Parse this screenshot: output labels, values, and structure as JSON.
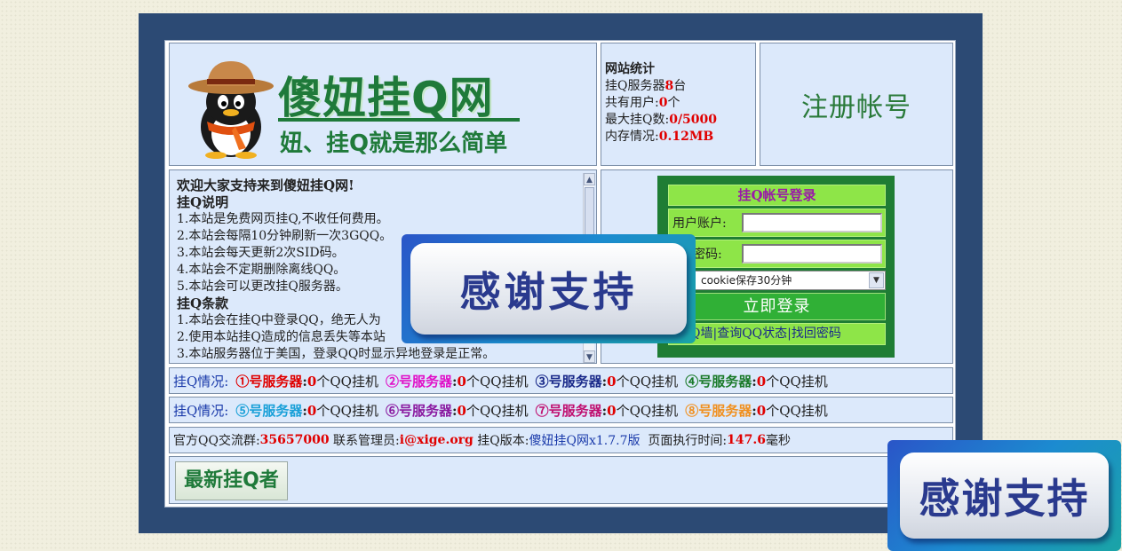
{
  "header": {
    "logo_title": "傻妞挂Q网",
    "logo_slogan": "妞、挂Q就是那么简单",
    "register_link": "注册帐号"
  },
  "stats": {
    "title": "网站统计",
    "servers_label": "挂Q服务器",
    "servers_value": "8",
    "servers_unit": "台",
    "users_label": "共有用户:",
    "users_value": "0",
    "users_unit": "个",
    "max_label": "最大挂Q数:",
    "max_value": "0/5000",
    "memory_label": "内存情况:",
    "memory_value": "0.12MB"
  },
  "info": {
    "welcome": "欢迎大家支持来到傻妞挂Q网!",
    "desc_head": "挂Q说明",
    "desc_items": [
      "1.本站是免费网页挂Q,不收任何费用。",
      "2.本站会每隔10分钟刷新一次3GQQ。",
      "3.本站会每天更新2次SID码。",
      "4.本站会不定期删除离线QQ。",
      "5.本站会可以更改挂Q服务器。"
    ],
    "terms_head": "挂Q条款",
    "terms_items": [
      "1.本站会在挂Q中登录QQ，绝无人为",
      "2.使用本站挂Q造成的信息丢失等本站",
      "3.本站服务器位于美国，登录QQ时显示异地登录是正常。"
    ]
  },
  "login": {
    "title": "挂Q帐号登录",
    "account_label": "用户账户:",
    "account_value": "",
    "password_label": "QQ密码:",
    "password_value": "",
    "cookie_select": "cookie保存30分钟",
    "submit": "立即登录",
    "links": [
      "挂Q墙",
      "查询QQ状态",
      "找回密码"
    ],
    "link_sep": "|"
  },
  "status_label": "挂Q情况:",
  "count_suffix": "个QQ挂机",
  "servers_row1": [
    {
      "name": "①号服务器",
      "colon": ":",
      "count": "0",
      "color": "#e00000"
    },
    {
      "name": "②号服务器",
      "colon": ":",
      "count": "0",
      "color": "#e010c8"
    },
    {
      "name": "③号服务器",
      "colon": ":",
      "count": "0",
      "color": "#1a2a8a"
    },
    {
      "name": "④号服务器",
      "colon": ":",
      "count": "0",
      "color": "#1a7a2a"
    }
  ],
  "servers_row2": [
    {
      "name": "⑤号服务器",
      "colon": ":",
      "count": "0",
      "color": "#1aa0d8"
    },
    {
      "name": "⑥号服务器",
      "colon": ":",
      "count": "0",
      "color": "#8a1aa0"
    },
    {
      "name": "⑦号服务器",
      "colon": ":",
      "count": "0",
      "color": "#c01070"
    },
    {
      "name": "⑧号服务器",
      "colon": ":",
      "count": "0",
      "color": "#f09020"
    }
  ],
  "footer": {
    "group_label": "官方QQ交流群:",
    "group_value": "35657000",
    "admin_label": " 联系管理员:",
    "admin_value": "i@xige.org",
    "version_label": " 挂Q版本:",
    "version_value": "傻妞挂Q网x1.7.7版",
    "time_label": "  页面执行时间:",
    "time_value": "147.6",
    "time_unit": "毫秒"
  },
  "latest_button": "最新挂Q者",
  "overlay_text": "感谢支持",
  "colors": {
    "green": "#1f7a3a",
    "red": "#e00000",
    "page_bg": "#2c4a74",
    "cell_bg": "#dce9fb"
  }
}
